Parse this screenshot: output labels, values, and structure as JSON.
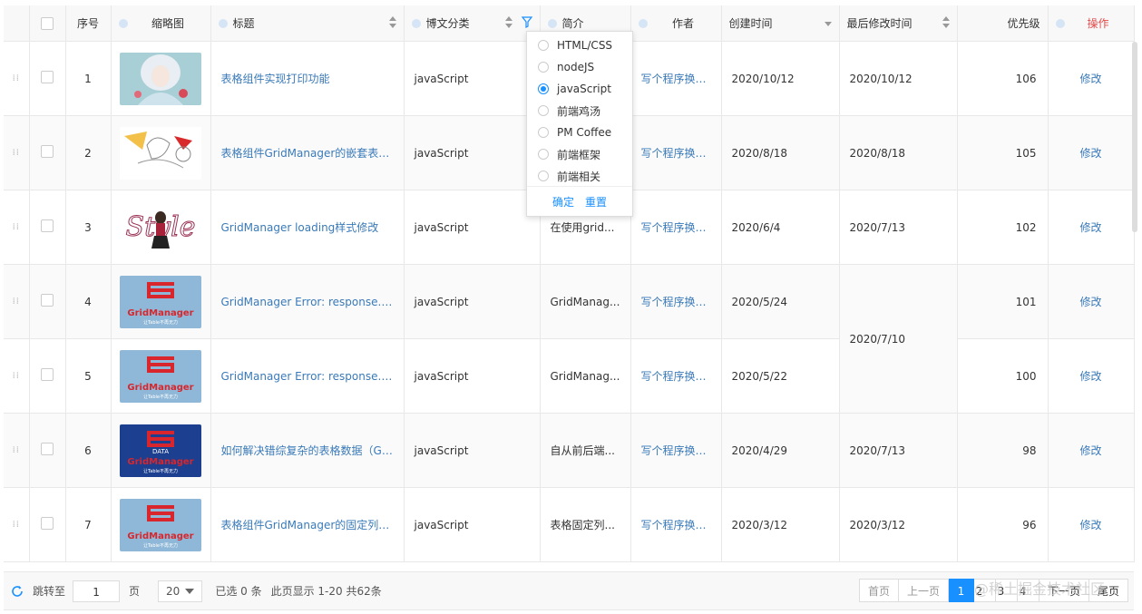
{
  "columns": {
    "index": "序号",
    "thumbnail": "缩略图",
    "title": "标题",
    "category": "博文分类",
    "summary": "简介",
    "author": "作者",
    "created": "创建时间",
    "modified": "最后修改时间",
    "priority": "优先级",
    "actions": "操作"
  },
  "rows": [
    {
      "index": "1",
      "title": "表格组件实现打印功能",
      "category": "javaScript",
      "summary": "",
      "author": "写个程序换个饼...",
      "created": "2020/10/12",
      "modified": "2020/10/12",
      "priority": "106",
      "action": "修改",
      "thumb": "anime-girl"
    },
    {
      "index": "2",
      "title": "表格组件GridManager的嵌套表头详解",
      "category": "javaScript",
      "summary": "",
      "author": "写个程序换个饼...",
      "created": "2020/8/18",
      "modified": "2020/8/18",
      "priority": "105",
      "action": "修改",
      "thumb": "anime-sketch"
    },
    {
      "index": "3",
      "title": "GridManager loading样式修改",
      "category": "javaScript",
      "summary": "在使用grid...",
      "author": "写个程序换个饼...",
      "created": "2020/6/4",
      "modified": "2020/7/13",
      "priority": "102",
      "action": "修改",
      "thumb": "style-girl"
    },
    {
      "index": "4",
      "title": "GridManager Error: response.totals undefined",
      "category": "javaScript",
      "summary": "GridManag...",
      "author": "写个程序换个饼...",
      "created": "2020/5/24",
      "modified": "2020/7/10",
      "priority": "101",
      "action": "修改",
      "thumb": "gridmanager-logo"
    },
    {
      "index": "5",
      "title": "GridManager Error: response.data is not array",
      "category": "javaScript",
      "summary": "GridManag...",
      "author": "写个程序换个饼...",
      "created": "2020/5/22",
      "modified": "",
      "priority": "100",
      "action": "修改",
      "thumb": "gridmanager-logo"
    },
    {
      "index": "6",
      "title": "如何解决错综复杂的表格数据（GridManager）",
      "category": "javaScript",
      "summary": "自从前后端...",
      "author": "写个程序换个饼...",
      "created": "2020/4/29",
      "modified": "2020/7/13",
      "priority": "98",
      "action": "修改",
      "thumb": "gridmanager-data"
    },
    {
      "index": "7",
      "title": "表格组件GridManager的固定列详解...",
      "category": "javaScript",
      "summary": "表格固定列...",
      "author": "写个程序换个饼...",
      "created": "2020/3/12",
      "modified": "2020/3/12",
      "priority": "96",
      "action": "修改",
      "thumb": "gridmanager-logo"
    }
  ],
  "logo_text": {
    "main": "GridManager",
    "sub": "让Table不再无力",
    "data": "DATA"
  },
  "style_text": "Style",
  "filter": {
    "options": [
      "HTML/CSS",
      "nodeJS",
      "javaScript",
      "前端鸡汤",
      "PM Coffee",
      "前端框架",
      "前端相关"
    ],
    "selected": "javaScript",
    "confirm": "确定",
    "reset": "重置"
  },
  "footer": {
    "jump_label": "跳转至",
    "jump_value": "1",
    "page_unit": "页",
    "page_size": "20",
    "selected_info": "已选 0 条",
    "range_info": "此页显示 1-20 共62条",
    "first": "首页",
    "prev": "上一页",
    "pages": [
      "1",
      "2",
      "3",
      "4"
    ],
    "current_page": "1",
    "next": "下一页",
    "last": "尾页"
  },
  "watermark": "@稀土掘金技术社区",
  "colors": {
    "link": "#3a7ab8",
    "accent": "#1890ff",
    "danger": "#e24b4b"
  }
}
